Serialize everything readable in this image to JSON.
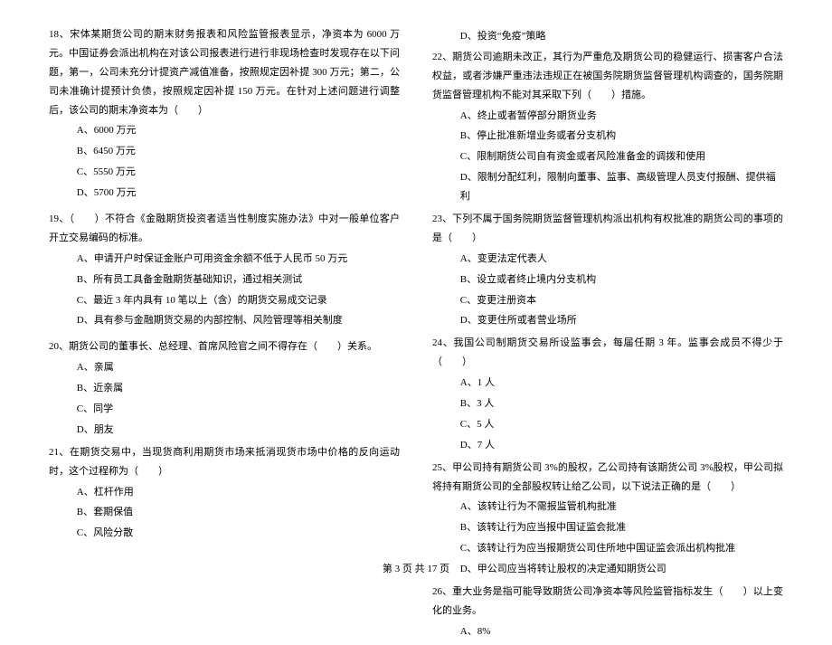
{
  "footer": "第 3 页 共 17 页",
  "left": {
    "q18": {
      "stem": "18、宋体某期货公司的期末财务报表和风险监管报表显示，净资本为 6000 万元。中国证券会派出机构在对该公司报表进行进行非现场检查时发现存在以下问题，第一，公司未充分计提资产减值准备，按照规定因补提 300 万元；第二，公司未准确计提预计负债，按照规定因补提 150 万元。在针对上述问题进行调整后，该公司的期末净资本为（　　）",
      "opts": [
        "A、6000 万元",
        "B、6450 万元",
        "C、5550 万元",
        "D、5700 万元"
      ]
    },
    "q19": {
      "stem": "19、（　　）不符合《金融期货投资者适当性制度实施办法》中对一般单位客户开立交易编码的标准。",
      "opts": [
        "A、申请开户时保证金账户可用资金余额不低于人民币 50 万元",
        "B、所有员工具备金融期货基础知识，通过相关测试",
        "C、最近 3 年内具有 10 笔以上（含）的期货交易成交记录",
        "D、具有参与金融期货交易的内部控制、风险管理等相关制度"
      ]
    },
    "q20": {
      "stem": "20、期货公司的董事长、总经理、首席风险官之间不得存在（　　）关系。",
      "opts": [
        "A、亲属",
        "B、近亲属",
        "C、同学",
        "D、朋友"
      ]
    },
    "q21": {
      "stem": "21、在期货交易中，当现货商利用期货市场来抵消现货市场中价格的反向运动时，这个过程称为（　　）",
      "opts": [
        "A、杠杆作用",
        "B、套期保值",
        "C、风险分散"
      ]
    }
  },
  "right": {
    "q21d": "D、投资“免疫”策略",
    "q22": {
      "stem": "22、期货公司逾期未改正，其行为严重危及期货公司的稳健运行、损害客户合法权益，或者涉嫌严重违法违规正在被国务院期货监督管理机构调查的，国务院期货监督管理机构不能对其采取下列（　　）措施。",
      "opts": [
        "A、终止或者暂停部分期货业务",
        "B、停止批准新增业务或者分支机构",
        "C、限制期货公司自有资金或者风险准备金的调拨和使用",
        "D、限制分配红利，限制向董事、监事、高级管理人员支付报酬、提供福利"
      ]
    },
    "q23": {
      "stem": "23、下列不属于国务院期货监督管理机构派出机构有权批准的期货公司的事项的是（　　）",
      "opts": [
        "A、变更法定代表人",
        "B、设立或者终止境内分支机构",
        "C、变更注册资本",
        "D、变更住所或者营业场所"
      ]
    },
    "q24": {
      "stem": "24、我国公司制期货交易所设监事会，每届任期 3 年。监事会成员不得少于（　　）",
      "opts": [
        "A、1 人",
        "B、3 人",
        "C、5 人",
        "D、7 人"
      ]
    },
    "q25": {
      "stem": "25、甲公司持有期货公司 3%的股权，乙公司持有该期货公司 3%股权，甲公司拟将持有期货公司的全部股权转让给乙公司，以下说法正确的是（　　）",
      "opts": [
        "A、该转让行为不需报监管机构批准",
        "B、该转让行为应当报中国证监会批准",
        "C、该转让行为应当报期货公司住所地中国证监会派出机构批准",
        "D、甲公司应当将转让股权的决定通知期货公司"
      ]
    },
    "q26": {
      "stem": "26、重大业务是指可能导致期货公司净资本等风险监管指标发生（　　）以上变化的业务。",
      "opts": [
        "A、8%"
      ]
    }
  }
}
